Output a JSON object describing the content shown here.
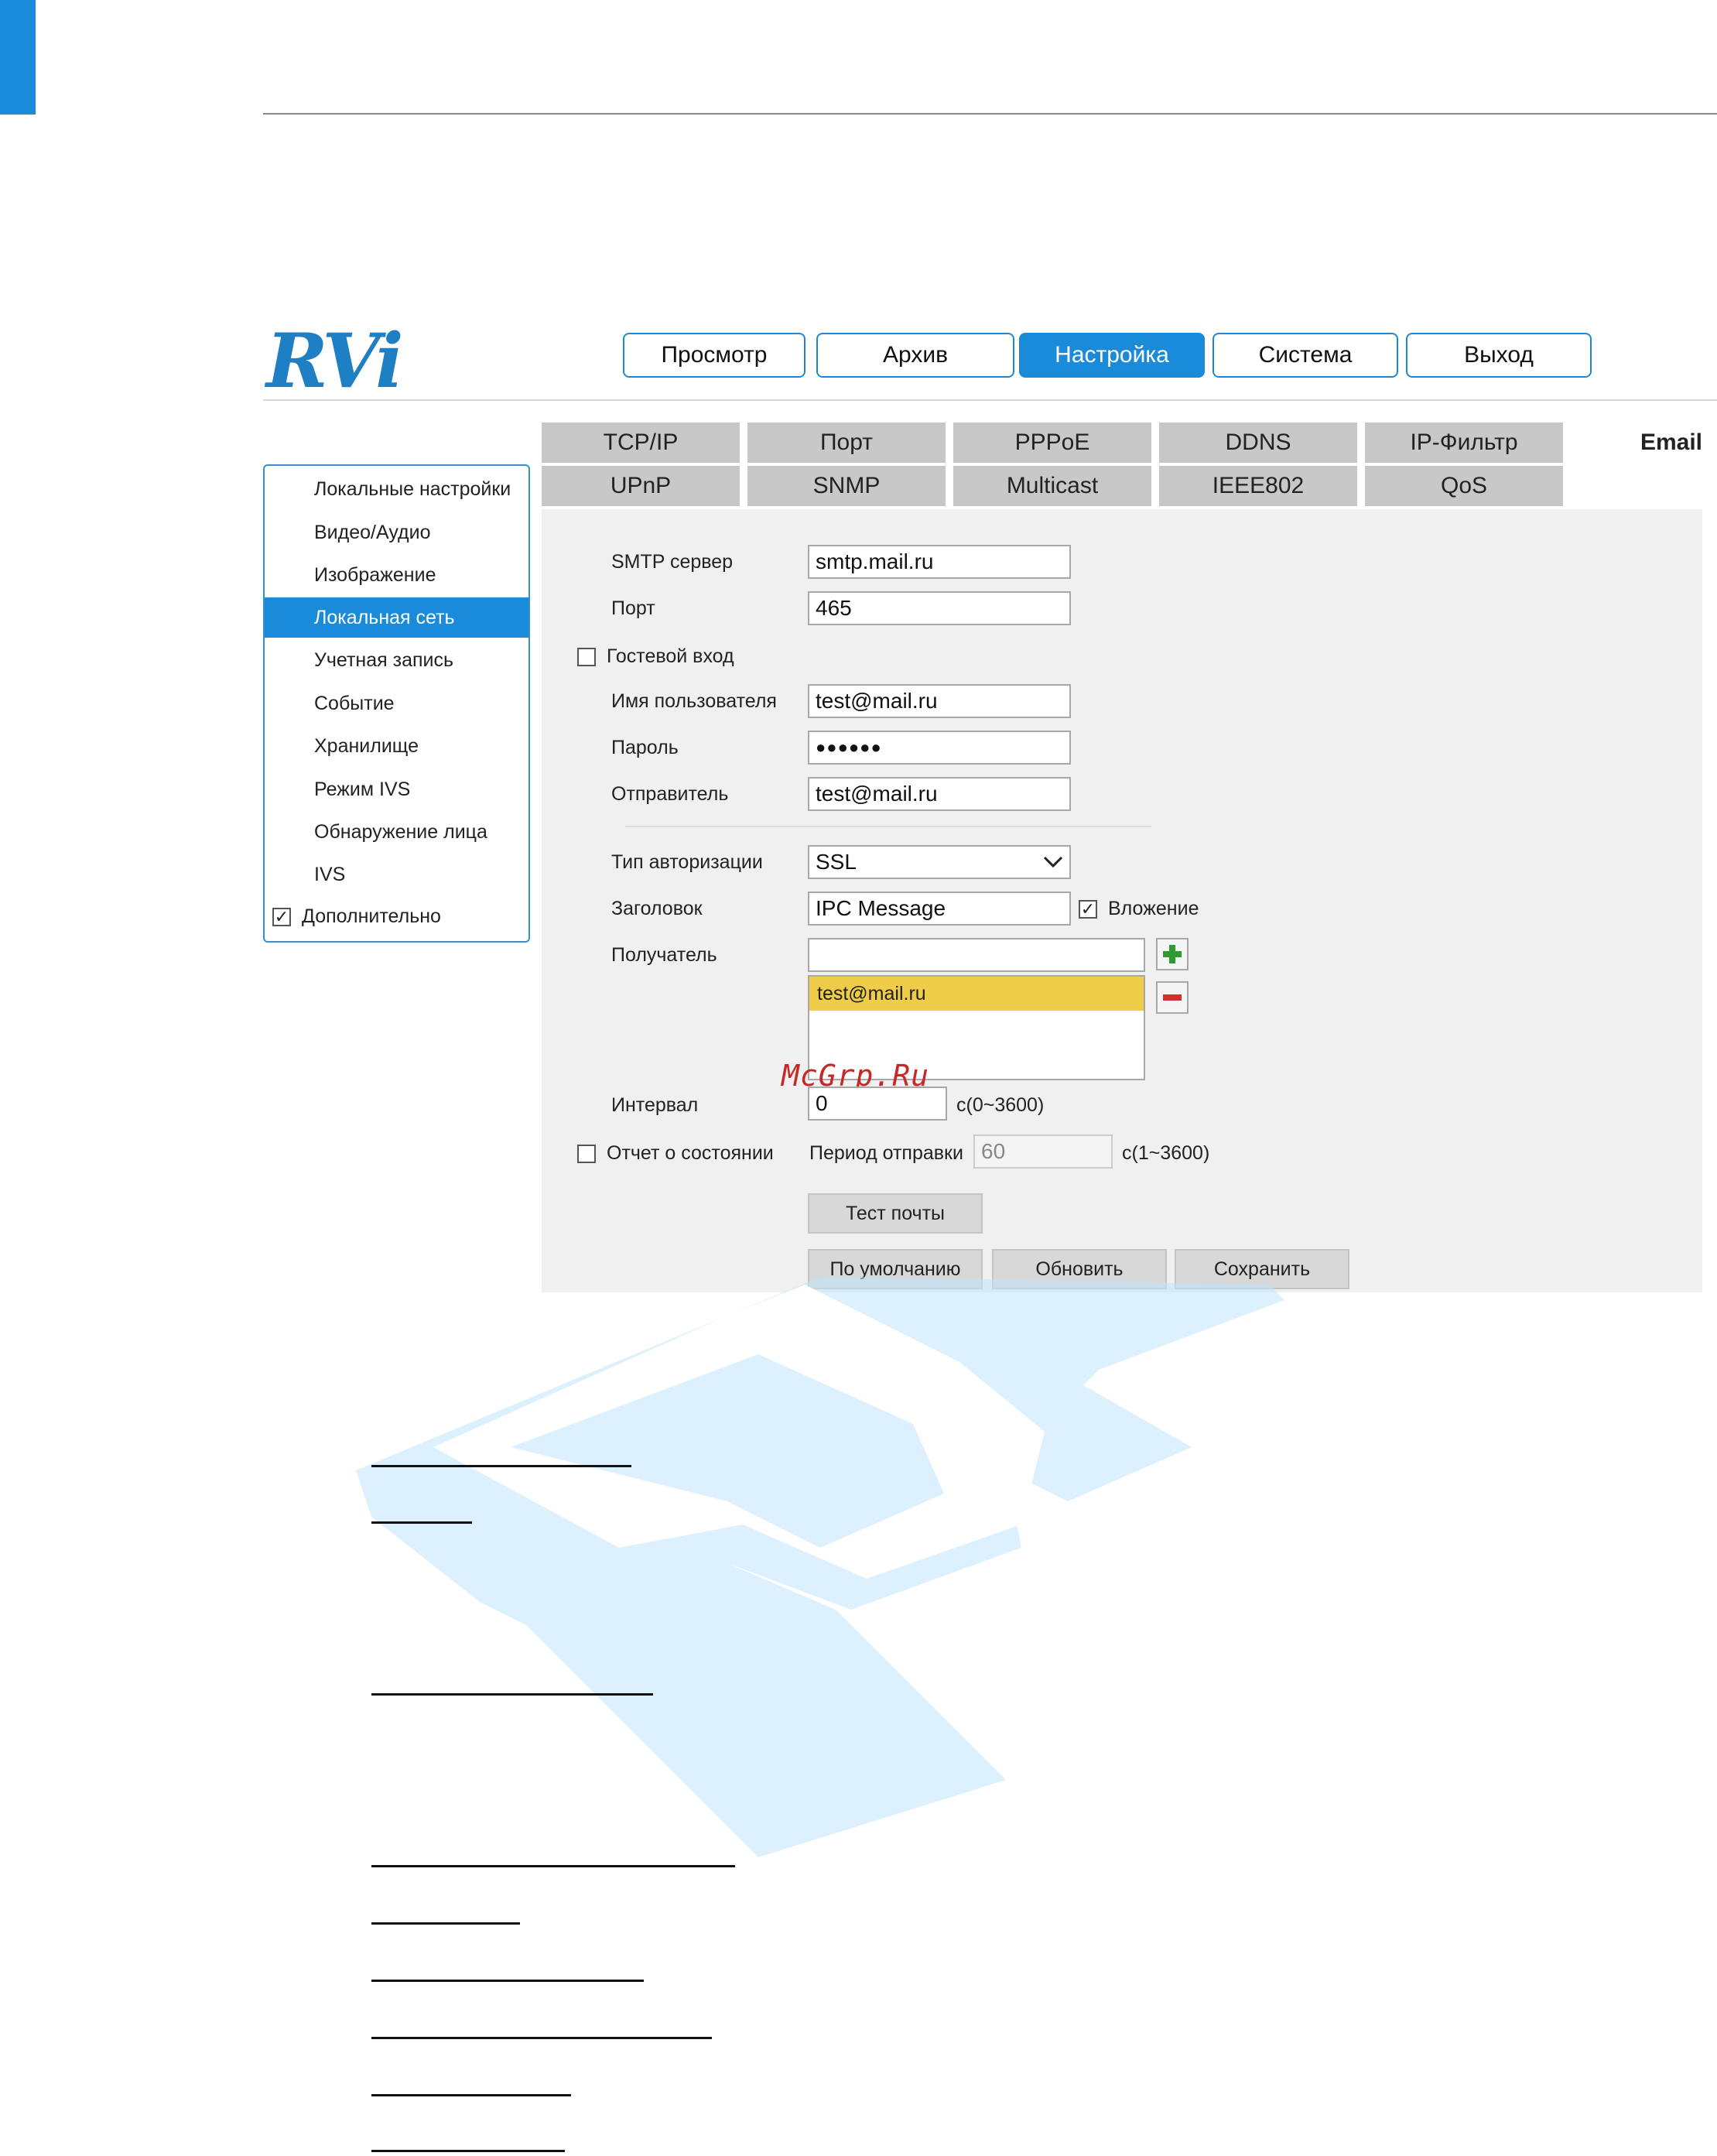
{
  "logo": {
    "text": "RVi"
  },
  "nav": [
    {
      "label": "Просмотр",
      "active": false
    },
    {
      "label": "Архив",
      "active": false
    },
    {
      "label": "Настройка",
      "active": true
    },
    {
      "label": "Система",
      "active": false
    },
    {
      "label": "Выход",
      "active": false
    }
  ],
  "sidebar": {
    "items": [
      {
        "label": "Локальные настройки"
      },
      {
        "label": "Видео/Аудио"
      },
      {
        "label": "Изображение"
      },
      {
        "label": "Локальная сеть",
        "active": true
      },
      {
        "label": "Учетная запись"
      },
      {
        "label": "Событие"
      },
      {
        "label": "Хранилище"
      },
      {
        "label": "Режим IVS"
      },
      {
        "label": "Обнаружение лица"
      },
      {
        "label": "IVS"
      }
    ],
    "extra": {
      "label": "Дополнительно",
      "checked": true
    }
  },
  "tabs": {
    "row1": [
      "TCP/IP",
      "Порт",
      "PPPoE",
      "DDNS",
      "IP-Фильтр"
    ],
    "row2": [
      "UPnP",
      "SNMP",
      "Multicast",
      "IEEE802",
      "QoS"
    ],
    "active": "Email"
  },
  "form": {
    "smtp_label": "SMTP сервер",
    "smtp_value": "smtp.mail.ru",
    "port_label": "Порт",
    "port_value": "465",
    "guest_label": "Гостевой вход",
    "guest_checked": false,
    "user_label": "Имя пользователя",
    "user_value": "test@mail.ru",
    "pass_label": "Пароль",
    "pass_value": "●●●●●●",
    "sender_label": "Отправитель",
    "sender_value": "test@mail.ru",
    "auth_label": "Тип авторизации",
    "auth_value": "SSL",
    "subject_label": "Заголовок",
    "subject_value": "IPC Message",
    "attach_label": "Вложение",
    "attach_checked": true,
    "recipient_label": "Получатель",
    "recipient_value": "",
    "recipients": [
      "test@mail.ru"
    ],
    "interval_label": "Интервал",
    "interval_value": "0",
    "interval_range": "с(0~3600)",
    "report_label": "Отчет о состоянии",
    "report_checked": false,
    "period_label": "Период отправки",
    "period_value": "60",
    "period_range": "с(1~3600)"
  },
  "buttons": {
    "test": "Тест почты",
    "default": "По умолчанию",
    "refresh": "Обновить",
    "save": "Сохранить"
  },
  "site_watermark": "McGrp.Ru",
  "colors": {
    "accent": "#1a8bd8",
    "selected_row": "#f0cd49",
    "watermark": "#bfe6fb"
  }
}
